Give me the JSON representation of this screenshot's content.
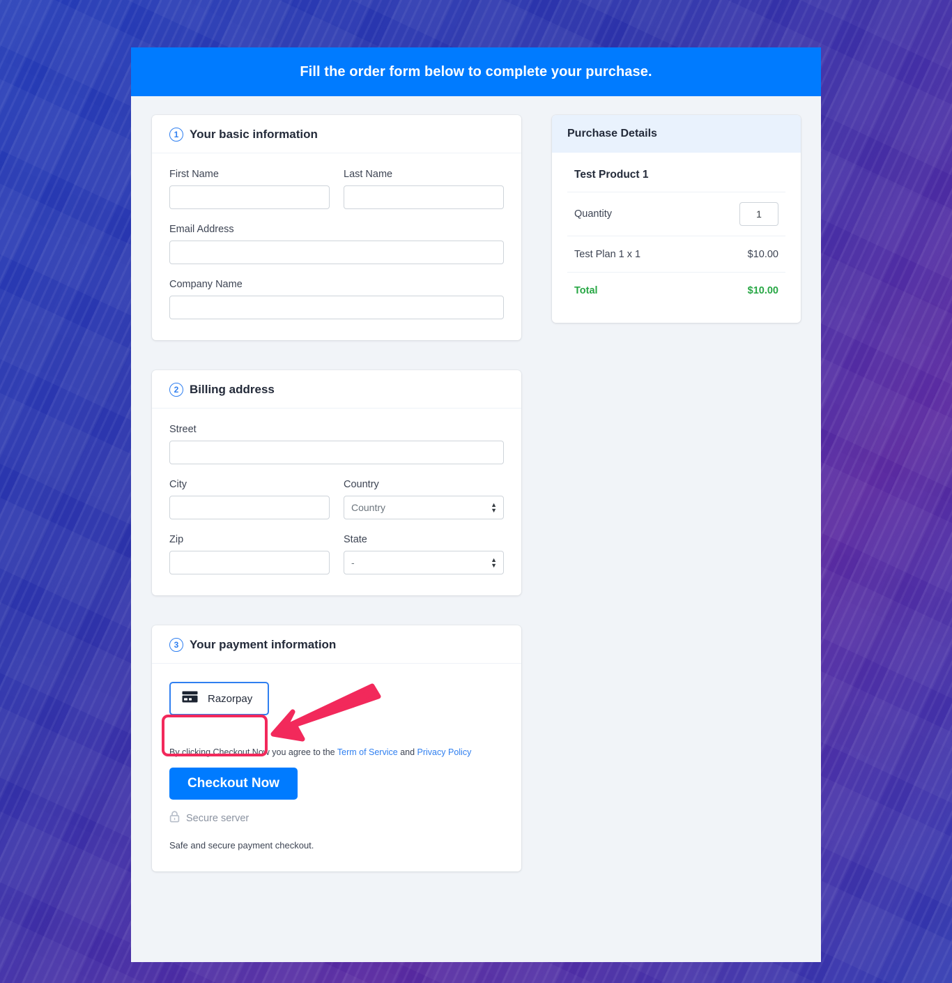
{
  "banner": {
    "text": "Fill the order form below to complete your purchase."
  },
  "sections": {
    "basic": {
      "step": "1",
      "title": "Your basic information",
      "fields": {
        "first_name": {
          "label": "First Name",
          "value": "",
          "placeholder": ""
        },
        "last_name": {
          "label": "Last Name",
          "value": "",
          "placeholder": ""
        },
        "email": {
          "label": "Email Address",
          "value": "",
          "placeholder": ""
        },
        "company": {
          "label": "Company Name",
          "value": "",
          "placeholder": ""
        }
      }
    },
    "billing": {
      "step": "2",
      "title": "Billing address",
      "fields": {
        "street": {
          "label": "Street",
          "value": "",
          "placeholder": ""
        },
        "city": {
          "label": "City",
          "value": "",
          "placeholder": ""
        },
        "country": {
          "label": "Country",
          "selected": "Country"
        },
        "zip": {
          "label": "Zip",
          "value": "",
          "placeholder": ""
        },
        "state": {
          "label": "State",
          "selected": "-"
        }
      }
    },
    "payment": {
      "step": "3",
      "title": "Your payment information",
      "option_label": "Razorpay",
      "option_icon": "credit-card-icon",
      "terms_prefix": "By clicking Checkout Now you agree to the ",
      "terms_link1": "Term of Service",
      "terms_middle": " and ",
      "terms_link2": "Privacy Policy",
      "checkout_label": "Checkout Now",
      "secure_icon": "lock-icon",
      "secure_label": "Secure server",
      "safe_note": "Safe and secure payment checkout."
    }
  },
  "purchase": {
    "heading": "Purchase Details",
    "product_name": "Test Product 1",
    "quantity_label": "Quantity",
    "quantity_value": "1",
    "plan_label": "Test Plan 1 x 1",
    "plan_price": "$10.00",
    "total_label": "Total",
    "total_price": "$10.00"
  },
  "annotation": {
    "highlight_color": "#f2295b",
    "arrow_color": "#f2295b",
    "target": "razorpay-payment-option"
  },
  "colors": {
    "accent_blue": "#007bff",
    "step_blue": "#2f7ff0",
    "total_green": "#28a745",
    "panel_head_blue": "#e9f2fd",
    "page_bg": "#f1f4f8"
  }
}
